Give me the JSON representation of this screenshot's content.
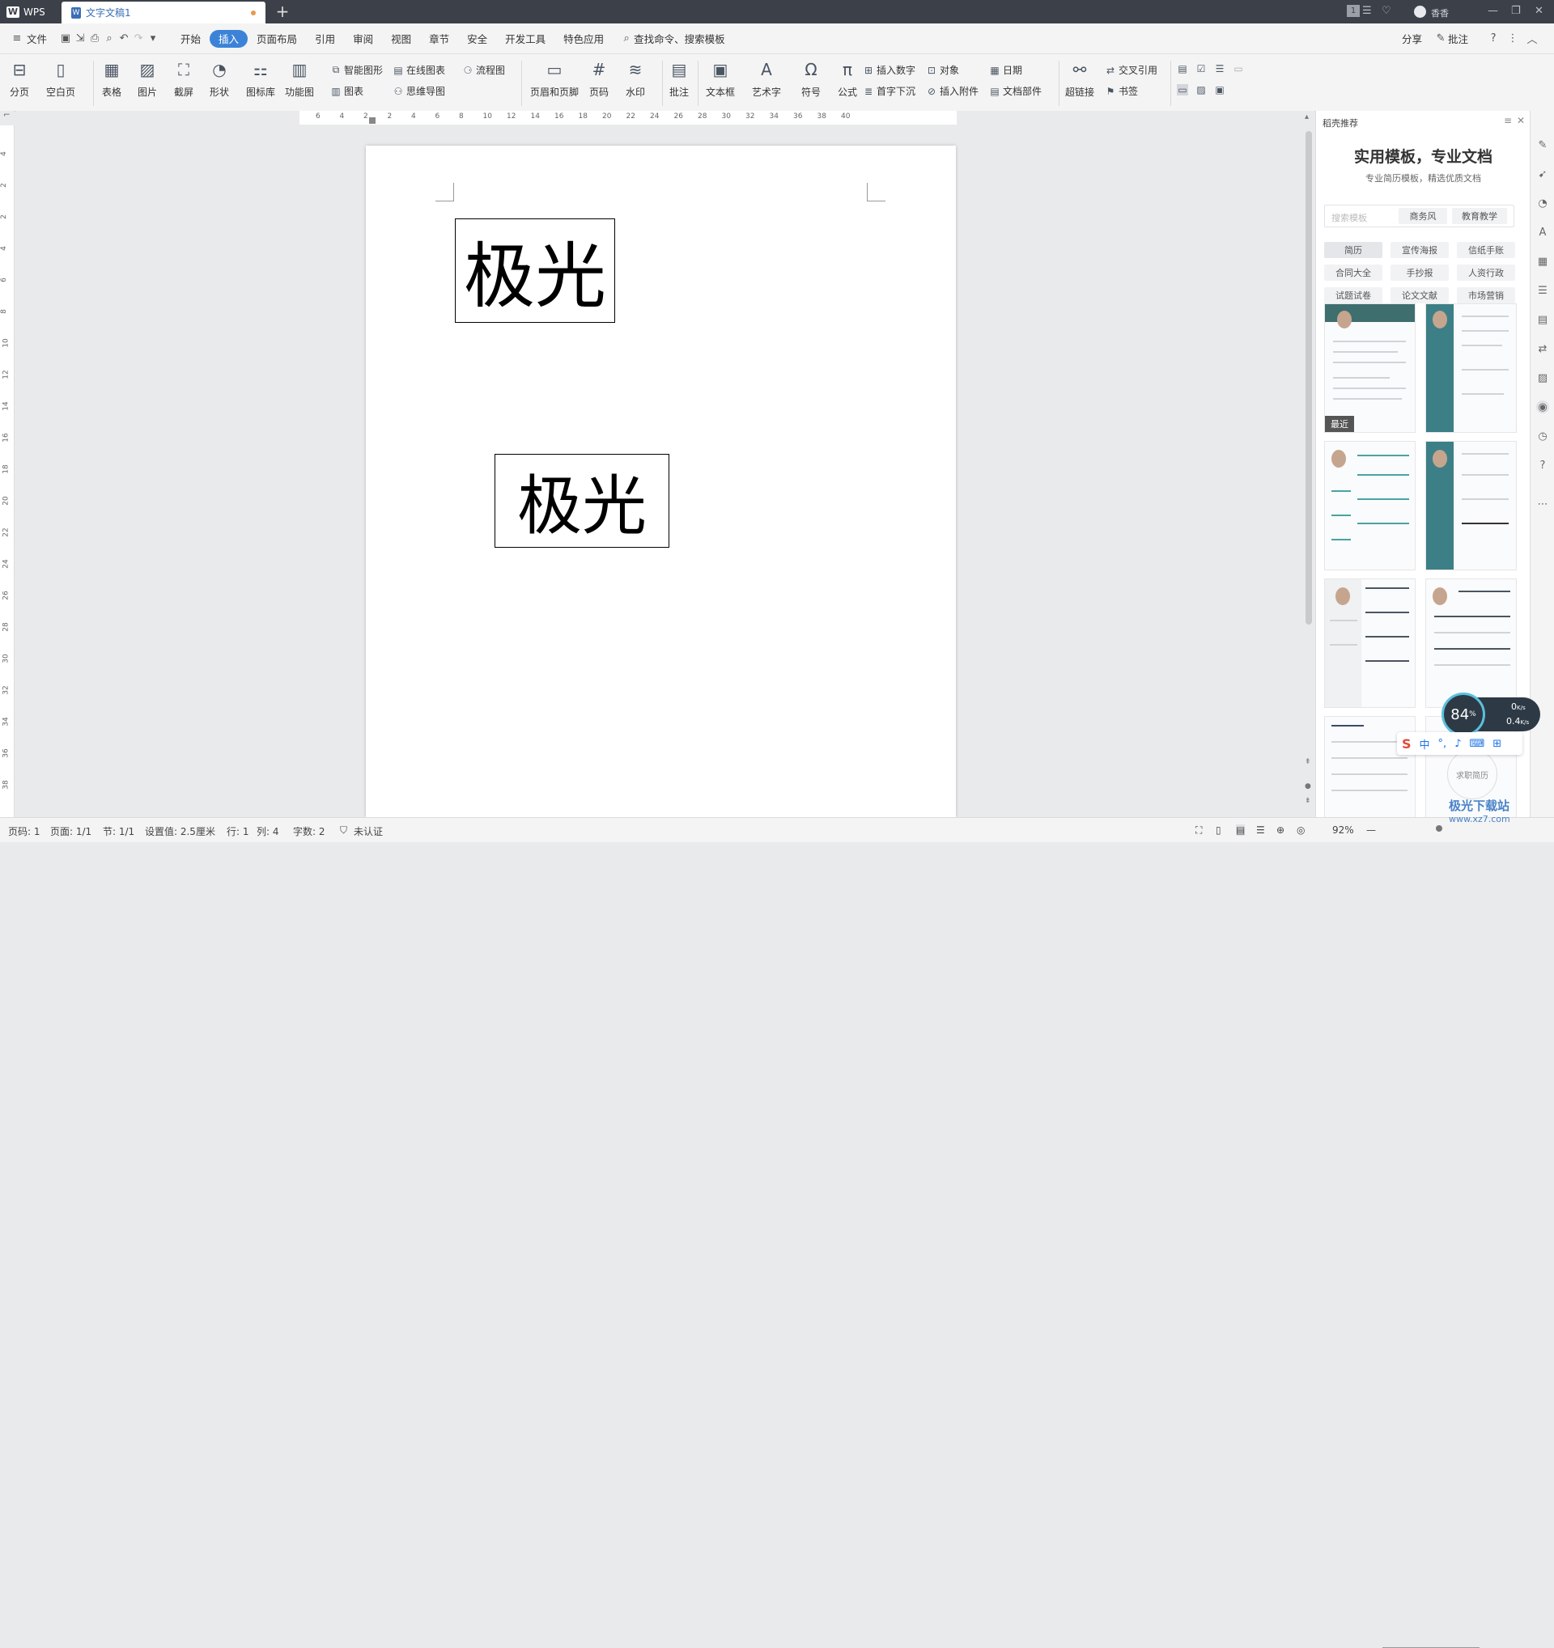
{
  "titlebar": {
    "app_name": "WPS",
    "doc_tab": "文字文稿1",
    "new_tab": "+",
    "user": "香香",
    "badge": "1"
  },
  "menubar": {
    "file": "文件",
    "tabs": [
      "开始",
      "插入",
      "页面布局",
      "引用",
      "审阅",
      "视图",
      "章节",
      "安全",
      "开发工具",
      "特色应用"
    ],
    "active_tab": "插入",
    "search": "查找命令、搜索模板",
    "share": "分享",
    "comment": "批注",
    "help": "?"
  },
  "ribbon": {
    "page_break": "分页",
    "blank_page": "空白页",
    "table": "表格",
    "picture": "图片",
    "screenshot": "截屏",
    "shape": "形状",
    "icon_lib": "图标库",
    "func_chart": "功能图",
    "smart_shape": "智能图形",
    "online_chart": "在线图表",
    "flowchart": "流程图",
    "chart": "图表",
    "mindmap": "思维导图",
    "header_footer": "页眉和页脚",
    "page_num": "页码",
    "watermark": "水印",
    "comment": "批注",
    "textbox": "文本框",
    "wordart": "艺术字",
    "symbol": "符号",
    "formula": "公式",
    "insert_number": "插入数字",
    "object": "对象",
    "date": "日期",
    "drop_cap": "首字下沉",
    "attachment": "插入附件",
    "doc_parts": "文档部件",
    "hyperlink": "超链接",
    "cross_ref": "交叉引用",
    "bookmark": "书签"
  },
  "ruler": {
    "h_ticks": [
      "6",
      "4",
      "2",
      "2",
      "4",
      "6",
      "8",
      "10",
      "12",
      "14",
      "16",
      "18",
      "20",
      "22",
      "24",
      "26",
      "28",
      "30",
      "32",
      "34",
      "36",
      "38",
      "40"
    ],
    "v_ticks": [
      "4",
      "2",
      "2",
      "4",
      "6",
      "8",
      "10",
      "12",
      "14",
      "16",
      "18",
      "20",
      "22",
      "24",
      "26",
      "28",
      "30",
      "32",
      "34",
      "36",
      "38"
    ]
  },
  "document": {
    "textbox1": "极光",
    "textbox2": "极光"
  },
  "pane": {
    "title": "稻壳推荐",
    "heading": "实用模板，专业文档",
    "subheading": "专业简历模板，精选优质文档",
    "search_placeholder": "搜索模板",
    "quick_tags": [
      "商务风",
      "教育教学"
    ],
    "tags": [
      "简历",
      "宣传海报",
      "信纸手账",
      "合同大全",
      "手抄报",
      "人资行政",
      "试题试卷",
      "论文文献",
      "市场营销"
    ],
    "recent_label": "最近",
    "card_label": "求职简历"
  },
  "status": {
    "page_code": "页码: 1",
    "page": "页面: 1/1",
    "section": "节: 1/1",
    "setting": "设置值: 2.5厘米",
    "row": "行: 1",
    "col": "列: 4",
    "wordcount": "字数: 2",
    "auth": "未认证",
    "zoom": "92%"
  },
  "overlay": {
    "gauge": "84",
    "gauge_unit": "%",
    "up_speed": "0",
    "down_speed": "0.4",
    "speed_unit": "K/s",
    "ime_lang": "中",
    "watermark": "极光下载站",
    "watermark_url": "www.xz7.com"
  },
  "colors": {
    "accent": "#3c83d8",
    "titlebar": "#3b4049",
    "resume_teal": "#3d7f86"
  }
}
